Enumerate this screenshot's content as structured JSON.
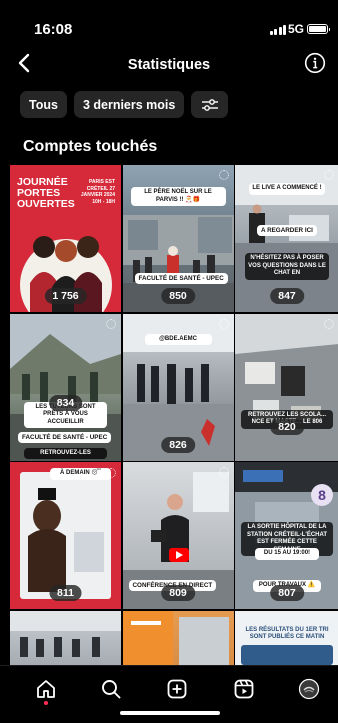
{
  "status_bar": {
    "time": "16:08",
    "network": "5G"
  },
  "header": {
    "title": "Statistiques"
  },
  "filters": {
    "period_all": "Tous",
    "period_recent": "3 derniers mois"
  },
  "section": {
    "title": "Comptes touchés"
  },
  "posts": [
    {
      "count": "1 756",
      "caption_1": "JOURNÉE PORTES OUVERTES",
      "caption_2": "PARIS EST CRÉTEIL 27 JANVIER 2024 10H - 18H"
    },
    {
      "count": "850",
      "caption": "LE PÈRE NOËL SUR LE PARVIS !! 🎅🎁",
      "tag": "FACULTÉ DE SANTÉ - UPEC"
    },
    {
      "count": "847",
      "caption": "LE LIVE A COMMENCÉ !",
      "tag": "A REGARDER ICI",
      "caption_2": "N'HÉSITEZ PAS À POSER VOS QUESTIONS DANS LE CHAT EN"
    },
    {
      "count": "834",
      "caption": "LES TUTEURS SONT PRÊTS À VOUS ACCUEILLIR",
      "tag": "FACULTÉ DE SANTÉ - UPEC",
      "caption_2": "RETROUVEZ-LES"
    },
    {
      "count": "826",
      "caption": "@BDE.AEMC"
    },
    {
      "count": "820",
      "caption": "RETROUVEZ LES SCOLA... NCE ET MASTE... LE 806"
    },
    {
      "count": "811",
      "caption": "À DEMAIN 😴"
    },
    {
      "count": "809",
      "tag": "CONFÉRENCE EN DIRECT"
    },
    {
      "count": "807",
      "caption": "LA SORTIE HÔPITAL DE LA STATION CRÉTEIL-L'ÉCHAT EST FERMÉE CETTE SEMAINE",
      "caption_2": "DU 15 AU 19:00!",
      "caption_3": "POUR TRAVAUX ⚠️",
      "badge": "8"
    },
    {
      "count": ""
    },
    {
      "count": ""
    },
    {
      "count": "",
      "caption": "LES RÉSULTATS DU 1ER TRI SONT PUBLIÉS CE MATIN"
    }
  ],
  "colors": {
    "accent": "#ff2d55",
    "chip": "#262626",
    "brand_red": "#d62a3a"
  },
  "icons": [
    "back-icon",
    "info-icon",
    "filter-icon",
    "home-icon",
    "search-icon",
    "create-icon",
    "reels-icon",
    "profile-icon"
  ]
}
